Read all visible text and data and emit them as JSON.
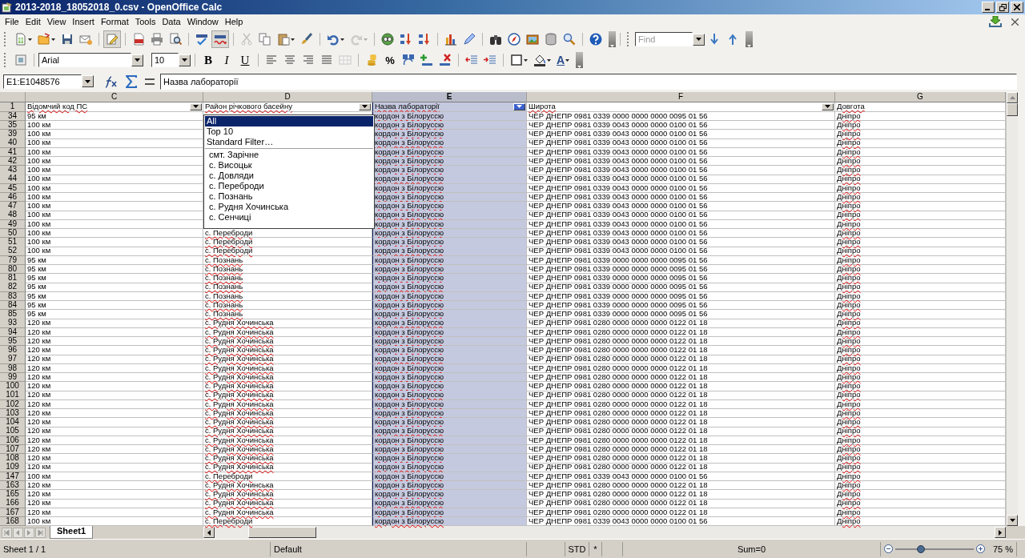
{
  "window": {
    "title": "2013-2018_18052018_0.csv - OpenOffice Calc"
  },
  "menu": [
    "File",
    "Edit",
    "View",
    "Insert",
    "Format",
    "Tools",
    "Data",
    "Window",
    "Help"
  ],
  "standard_toolbar": [
    [
      {
        "kind": "new",
        "menu": true,
        "pressed": false,
        "disabled": false
      },
      {
        "kind": "open",
        "menu": true,
        "pressed": false,
        "disabled": false
      },
      {
        "kind": "save",
        "menu": false,
        "pressed": false,
        "disabled": false
      },
      {
        "kind": "mail",
        "menu": false,
        "pressed": false,
        "disabled": false
      }
    ],
    [
      {
        "kind": "edit",
        "menu": false,
        "pressed": true,
        "disabled": false
      }
    ],
    [
      {
        "kind": "pdf",
        "menu": false,
        "pressed": false,
        "disabled": false
      },
      {
        "kind": "print",
        "menu": false,
        "pressed": false,
        "disabled": false
      },
      {
        "kind": "preview",
        "menu": false,
        "pressed": false,
        "disabled": false
      }
    ],
    [
      {
        "kind": "spell",
        "menu": false,
        "pressed": false,
        "disabled": false
      },
      {
        "kind": "autospell",
        "menu": false,
        "pressed": true,
        "disabled": false
      }
    ],
    [
      {
        "kind": "cut",
        "menu": false,
        "pressed": false,
        "disabled": true
      },
      {
        "kind": "copy",
        "menu": false,
        "pressed": false,
        "disabled": false
      },
      {
        "kind": "paste",
        "menu": true,
        "pressed": false,
        "disabled": false
      },
      {
        "kind": "brush",
        "menu": false,
        "pressed": false,
        "disabled": false
      }
    ],
    [
      {
        "kind": "undo",
        "menu": true,
        "pressed": false,
        "disabled": false
      },
      {
        "kind": "redo",
        "menu": true,
        "pressed": false,
        "disabled": true
      }
    ],
    [
      {
        "kind": "hyperlink",
        "menu": false,
        "pressed": false,
        "disabled": false
      },
      {
        "kind": "sortasc",
        "menu": false,
        "pressed": false,
        "disabled": false
      },
      {
        "kind": "sortdesc",
        "menu": false,
        "pressed": false,
        "disabled": false
      }
    ],
    [
      {
        "kind": "chart",
        "menu": false,
        "pressed": false,
        "disabled": false
      },
      {
        "kind": "draw",
        "menu": false,
        "pressed": false,
        "disabled": false
      }
    ],
    [
      {
        "kind": "find",
        "menu": false,
        "pressed": false,
        "disabled": false
      },
      {
        "kind": "navigator",
        "menu": false,
        "pressed": false,
        "disabled": false
      },
      {
        "kind": "gallery",
        "menu": false,
        "pressed": false,
        "disabled": false
      },
      {
        "kind": "database",
        "menu": false,
        "pressed": false,
        "disabled": false
      },
      {
        "kind": "zoom",
        "menu": false,
        "pressed": false,
        "disabled": false
      }
    ],
    [
      {
        "kind": "help",
        "menu": false,
        "pressed": false,
        "disabled": false
      }
    ]
  ],
  "find_toolbar": {
    "placeholder": "Find"
  },
  "formatting_toolbar": {
    "font_name": "Arial",
    "font_size": "10",
    "groups": [
      [
        {
          "kind": "bold",
          "label": "B",
          "menu": false,
          "pressed": false,
          "disabled": false
        },
        {
          "kind": "italic",
          "label": "I",
          "menu": false,
          "pressed": false,
          "disabled": false
        },
        {
          "kind": "underline",
          "label": "U",
          "menu": false,
          "pressed": false,
          "disabled": false
        }
      ],
      [
        {
          "kind": "left",
          "menu": false,
          "pressed": false,
          "disabled": false
        },
        {
          "kind": "center",
          "menu": false,
          "pressed": false,
          "disabled": false
        },
        {
          "kind": "right",
          "menu": false,
          "pressed": false,
          "disabled": false
        },
        {
          "kind": "justify",
          "menu": false,
          "pressed": false,
          "disabled": false
        },
        {
          "kind": "merge",
          "menu": false,
          "pressed": false,
          "disabled": true
        }
      ],
      [
        {
          "kind": "currency",
          "menu": false,
          "pressed": false,
          "disabled": false
        },
        {
          "kind": "percent",
          "label": "%",
          "menu": false,
          "pressed": false,
          "disabled": false
        },
        {
          "kind": "standard",
          "menu": false,
          "pressed": false,
          "disabled": false
        },
        {
          "kind": "adddec",
          "menu": false,
          "pressed": false,
          "disabled": false
        },
        {
          "kind": "deldec",
          "menu": false,
          "pressed": false,
          "disabled": false
        }
      ],
      [
        {
          "kind": "outdent",
          "menu": false,
          "pressed": false,
          "disabled": false
        },
        {
          "kind": "indent",
          "menu": false,
          "pressed": false,
          "disabled": false
        }
      ],
      [
        {
          "kind": "borders",
          "menu": true,
          "pressed": false,
          "disabled": false
        },
        {
          "kind": "bgcolor",
          "menu": true,
          "pressed": false,
          "disabled": false
        },
        {
          "kind": "fontcolor",
          "label": "A",
          "menu": true,
          "pressed": false,
          "disabled": false
        }
      ]
    ]
  },
  "formula_bar": {
    "name_box": "E1:E1048576",
    "content": "Назва лабораторії"
  },
  "sheet": {
    "columns": [
      {
        "letter": "C",
        "selected": false
      },
      {
        "letter": "D",
        "selected": false
      },
      {
        "letter": "E",
        "selected": true
      },
      {
        "letter": "F",
        "selected": false
      },
      {
        "letter": "G",
        "selected": false
      }
    ],
    "header_row": {
      "number": "1",
      "cells": [
        {
          "text": "Відомчий код ПС",
          "filter": true
        },
        {
          "text": "Район річкового басейну",
          "filter": true
        },
        {
          "text": "Назва лабораторії",
          "filter": true
        },
        {
          "text": "Широта",
          "filter": true
        },
        {
          "text": "Довгота",
          "filter": false
        }
      ]
    },
    "rows": [
      {
        "number": "34",
        "cells": [
          "95 км",
          null,
          "кордон з Білоруссю",
          "ЧЕР ДНЕПР 0981 0339 0000 0000 0000 0095 01 56",
          "Дніпро"
        ]
      },
      {
        "number": "35",
        "cells": [
          "100 км",
          null,
          "кордон з Білоруссю",
          "ЧЕР ДНЕПР 0981 0339 0043 0000 0000 0100 01 56",
          "Дніпро"
        ]
      },
      {
        "number": "39",
        "cells": [
          "100 км",
          null,
          "кордон з Білоруссю",
          "ЧЕР ДНЕПР 0981 0339 0043 0000 0000 0100 01 56",
          "Дніпро"
        ]
      },
      {
        "number": "40",
        "cells": [
          "100 км",
          null,
          "кордон з Білоруссю",
          "ЧЕР ДНЕПР 0981 0339 0043 0000 0000 0100 01 56",
          "Дніпро"
        ]
      },
      {
        "number": "41",
        "cells": [
          "100 км",
          null,
          "кордон з Білоруссю",
          "ЧЕР ДНЕПР 0981 0339 0043 0000 0000 0100 01 56",
          "Дніпро"
        ]
      },
      {
        "number": "42",
        "cells": [
          "100 км",
          null,
          "кордон з Білоруссю",
          "ЧЕР ДНЕПР 0981 0339 0043 0000 0000 0100 01 56",
          "Дніпро"
        ]
      },
      {
        "number": "43",
        "cells": [
          "100 км",
          null,
          "кордон з Білоруссю",
          "ЧЕР ДНЕПР 0981 0339 0043 0000 0000 0100 01 56",
          "Дніпро"
        ]
      },
      {
        "number": "44",
        "cells": [
          "100 км",
          null,
          "кордон з Білоруссю",
          "ЧЕР ДНЕПР 0981 0339 0043 0000 0000 0100 01 56",
          "Дніпро"
        ]
      },
      {
        "number": "45",
        "cells": [
          "100 км",
          null,
          "кордон з Білоруссю",
          "ЧЕР ДНЕПР 0981 0339 0043 0000 0000 0100 01 56",
          "Дніпро"
        ]
      },
      {
        "number": "46",
        "cells": [
          "100 км",
          null,
          "кордон з Білоруссю",
          "ЧЕР ДНЕПР 0981 0339 0043 0000 0000 0100 01 56",
          "Дніпро"
        ]
      },
      {
        "number": "47",
        "cells": [
          "100 км",
          null,
          "кордон з Білоруссю",
          "ЧЕР ДНЕПР 0981 0339 0043 0000 0000 0100 01 56",
          "Дніпро"
        ]
      },
      {
        "number": "48",
        "cells": [
          "100 км",
          null,
          "кордон з Білоруссю",
          "ЧЕР ДНЕПР 0981 0339 0043 0000 0000 0100 01 56",
          "Дніпро"
        ]
      },
      {
        "number": "49",
        "cells": [
          "100 км",
          null,
          "кордон з Білоруссю",
          "ЧЕР ДНЕПР 0981 0339 0043 0000 0000 0100 01 56",
          "Дніпро"
        ]
      },
      {
        "number": "50",
        "cells": [
          "100 км",
          "с. Переброди",
          "кордон з Білоруссю",
          "ЧЕР ДНЕПР 0981 0339 0043 0000 0000 0100 01 56",
          "Дніпро"
        ]
      },
      {
        "number": "51",
        "cells": [
          "100 км",
          "с. Переброди",
          "кордон з Білоруссю",
          "ЧЕР ДНЕПР 0981 0339 0043 0000 0000 0100 01 56",
          "Дніпро"
        ]
      },
      {
        "number": "52",
        "cells": [
          "100 км",
          "с. Переброди",
          "кордон з Білоруссю",
          "ЧЕР ДНЕПР 0981 0339 0043 0000 0000 0100 01 56",
          "Дніпро"
        ]
      },
      {
        "number": "79",
        "cells": [
          "95 км",
          "с. Познань",
          "кордон з Білоруссю",
          "ЧЕР ДНЕПР 0981 0339 0000 0000 0000 0095 01 56",
          "Дніпро"
        ]
      },
      {
        "number": "80",
        "cells": [
          "95 км",
          "с. Познань",
          "кордон з Білоруссю",
          "ЧЕР ДНЕПР 0981 0339 0000 0000 0000 0095 01 56",
          "Дніпро"
        ]
      },
      {
        "number": "81",
        "cells": [
          "95 км",
          "с. Познань",
          "кордон з Білоруссю",
          "ЧЕР ДНЕПР 0981 0339 0000 0000 0000 0095 01 56",
          "Дніпро"
        ]
      },
      {
        "number": "82",
        "cells": [
          "95 км",
          "с. Познань",
          "кордон з Білоруссю",
          "ЧЕР ДНЕПР 0981 0339 0000 0000 0000 0095 01 56",
          "Дніпро"
        ]
      },
      {
        "number": "83",
        "cells": [
          "95 км",
          "с. Познань",
          "кордон з Білоруссю",
          "ЧЕР ДНЕПР 0981 0339 0000 0000 0000 0095 01 56",
          "Дніпро"
        ]
      },
      {
        "number": "84",
        "cells": [
          "95 км",
          "с. Познань",
          "кордон з Білоруссю",
          "ЧЕР ДНЕПР 0981 0339 0000 0000 0000 0095 01 56",
          "Дніпро"
        ]
      },
      {
        "number": "85",
        "cells": [
          "95 км",
          "с. Познань",
          "кордон з Білоруссю",
          "ЧЕР ДНЕПР 0981 0339 0000 0000 0000 0095 01 56",
          "Дніпро"
        ]
      },
      {
        "number": "93",
        "cells": [
          "120 км",
          "с. Рудня Хочинська",
          "кордон з Білоруссю",
          "ЧЕР ДНЕПР 0981 0280 0000 0000 0000 0122 01 18",
          "Дніпро"
        ]
      },
      {
        "number": "94",
        "cells": [
          "120 км",
          "с. Рудня Хочинська",
          "кордон з Білоруссю",
          "ЧЕР ДНЕПР 0981 0280 0000 0000 0000 0122 01 18",
          "Дніпро"
        ]
      },
      {
        "number": "95",
        "cells": [
          "120 км",
          "с. Рудня Хочинська",
          "кордон з Білоруссю",
          "ЧЕР ДНЕПР 0981 0280 0000 0000 0000 0122 01 18",
          "Дніпро"
        ]
      },
      {
        "number": "96",
        "cells": [
          "120 км",
          "с. Рудня Хочинська",
          "кордон з Білоруссю",
          "ЧЕР ДНЕПР 0981 0280 0000 0000 0000 0122 01 18",
          "Дніпро"
        ]
      },
      {
        "number": "97",
        "cells": [
          "120 км",
          "с. Рудня Хочинська",
          "кордон з Білоруссю",
          "ЧЕР ДНЕПР 0981 0280 0000 0000 0000 0122 01 18",
          "Дніпро"
        ]
      },
      {
        "number": "98",
        "cells": [
          "120 км",
          "с. Рудня Хочинська",
          "кордон з Білоруссю",
          "ЧЕР ДНЕПР 0981 0280 0000 0000 0000 0122 01 18",
          "Дніпро"
        ]
      },
      {
        "number": "99",
        "cells": [
          "120 км",
          "с. Рудня Хочинська",
          "кордон з Білоруссю",
          "ЧЕР ДНЕПР 0981 0280 0000 0000 0000 0122 01 18",
          "Дніпро"
        ]
      },
      {
        "number": "100",
        "cells": [
          "120 км",
          "с. Рудня Хочинська",
          "кордон з Білоруссю",
          "ЧЕР ДНЕПР 0981 0280 0000 0000 0000 0122 01 18",
          "Дніпро"
        ]
      },
      {
        "number": "101",
        "cells": [
          "120 км",
          "с. Рудня Хочинська",
          "кордон з Білоруссю",
          "ЧЕР ДНЕПР 0981 0280 0000 0000 0000 0122 01 18",
          "Дніпро"
        ]
      },
      {
        "number": "102",
        "cells": [
          "120 км",
          "с. Рудня Хочинська",
          "кордон з Білоруссю",
          "ЧЕР ДНЕПР 0981 0280 0000 0000 0000 0122 01 18",
          "Дніпро"
        ]
      },
      {
        "number": "103",
        "cells": [
          "120 км",
          "с. Рудня Хочинська",
          "кордон з Білоруссю",
          "ЧЕР ДНЕПР 0981 0280 0000 0000 0000 0122 01 18",
          "Дніпро"
        ]
      },
      {
        "number": "104",
        "cells": [
          "120 км",
          "с. Рудня Хочинська",
          "кордон з Білоруссю",
          "ЧЕР ДНЕПР 0981 0280 0000 0000 0000 0122 01 18",
          "Дніпро"
        ]
      },
      {
        "number": "105",
        "cells": [
          "120 км",
          "с. Рудня Хочинська",
          "кордон з Білоруссю",
          "ЧЕР ДНЕПР 0981 0280 0000 0000 0000 0122 01 18",
          "Дніпро"
        ]
      },
      {
        "number": "106",
        "cells": [
          "120 км",
          "с. Рудня Хочинська",
          "кордон з Білоруссю",
          "ЧЕР ДНЕПР 0981 0280 0000 0000 0000 0122 01 18",
          "Дніпро"
        ]
      },
      {
        "number": "107",
        "cells": [
          "120 км",
          "с. Рудня Хочинська",
          "кордон з Білоруссю",
          "ЧЕР ДНЕПР 0981 0280 0000 0000 0000 0122 01 18",
          "Дніпро"
        ]
      },
      {
        "number": "108",
        "cells": [
          "120 км",
          "с. Рудня Хочинська",
          "кордон з Білоруссю",
          "ЧЕР ДНЕПР 0981 0280 0000 0000 0000 0122 01 18",
          "Дніпро"
        ]
      },
      {
        "number": "109",
        "cells": [
          "120 км",
          "с. Рудня Хочинська",
          "кордон з Білоруссю",
          "ЧЕР ДНЕПР 0981 0280 0000 0000 0000 0122 01 18",
          "Дніпро"
        ]
      },
      {
        "number": "147",
        "cells": [
          "100 км",
          "с. Переброди",
          "кордон з Білоруссю",
          "ЧЕР ДНЕПР 0981 0339 0043 0000 0000 0100 01 56",
          "Дніпро"
        ]
      },
      {
        "number": "163",
        "cells": [
          "120 км",
          "с. Рудня Хочинська",
          "кордон з Білоруссю",
          "ЧЕР ДНЕПР 0981 0280 0000 0000 0000 0122 01 18",
          "Дніпро"
        ]
      },
      {
        "number": "165",
        "cells": [
          "120 км",
          "с. Рудня Хочинська",
          "кордон з Білоруссю",
          "ЧЕР ДНЕПР 0981 0280 0000 0000 0000 0122 01 18",
          "Дніпро"
        ]
      },
      {
        "number": "166",
        "cells": [
          "120 км",
          "с. Рудня Хочинська",
          "кордон з Білоруссю",
          "ЧЕР ДНЕПР 0981 0280 0000 0000 0000 0122 01 18",
          "Дніпро"
        ]
      },
      {
        "number": "167",
        "cells": [
          "120 км",
          "с. Рудня Хочинська",
          "кордон з Білоруссю",
          "ЧЕР ДНЕПР 0981 0280 0000 0000 0000 0122 01 18",
          "Дніпро"
        ]
      },
      {
        "number": "168",
        "cells": [
          "100 км",
          "с. Переброди",
          "кордон з Білоруссю",
          "ЧЕР ДНЕПР 0981 0339 0043 0000 0000 0100 01 56",
          "Дніпро"
        ]
      }
    ],
    "filter_dropdown": {
      "items": [
        {
          "kind": "command",
          "label": "All",
          "selected": true
        },
        {
          "kind": "command",
          "label": "Top 10",
          "selected": false
        },
        {
          "kind": "command",
          "label": "Standard Filter…",
          "selected": false
        },
        {
          "kind": "value",
          "label": "смт. Зарічне",
          "selected": false
        },
        {
          "kind": "value",
          "label": "с. Висоцьк",
          "selected": false
        },
        {
          "kind": "value",
          "label": "с. Довляди",
          "selected": false
        },
        {
          "kind": "value",
          "label": "с. Переброди",
          "selected": false
        },
        {
          "kind": "value",
          "label": "с. Познань",
          "selected": false
        },
        {
          "kind": "value",
          "label": "с. Рудня Хочинська",
          "selected": false
        },
        {
          "kind": "value",
          "label": "с. Сенчиці",
          "selected": false
        }
      ]
    }
  },
  "sheet_tabs": [
    {
      "label": "Sheet1",
      "selected": true
    }
  ],
  "status_bar": {
    "sheet": "Sheet 1 / 1",
    "page_style": "Default",
    "mode": "STD",
    "modified": "*",
    "sum": "Sum=0",
    "zoom": {
      "level": 0.33,
      "reading": "75 %"
    }
  }
}
